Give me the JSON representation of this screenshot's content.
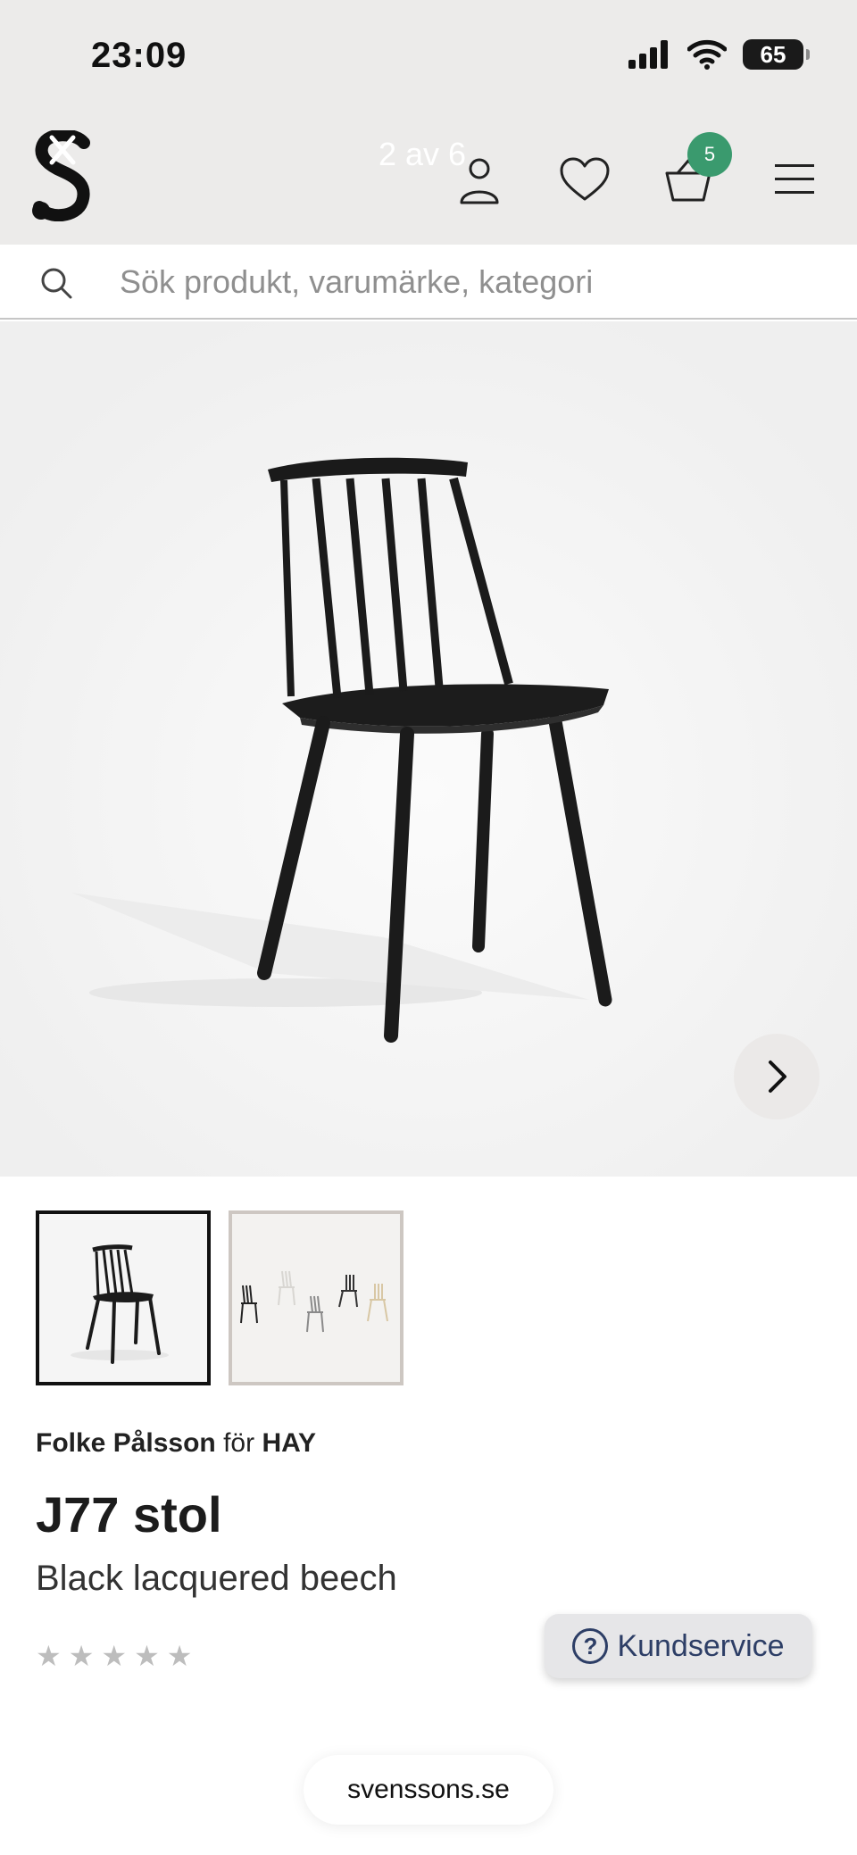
{
  "status_bar": {
    "time": "23:09",
    "battery": "65"
  },
  "header": {
    "gallery_counter": "2 av 6",
    "cart_count": "5",
    "icons": [
      "account-icon",
      "heart-icon",
      "cart-icon",
      "menu-icon"
    ]
  },
  "search": {
    "placeholder": "Sök produkt, varumärke, kategori"
  },
  "product": {
    "designer": "Folke Pålsson",
    "designer_connector": "för",
    "brand": "HAY",
    "title": "J77 stol",
    "variant": "Black lacquered beech",
    "rating_stars": 5,
    "rating_value": 0
  },
  "support": {
    "label": "Kundservice"
  },
  "browser": {
    "url": "svenssons.se"
  },
  "colors": {
    "header_bg": "#ecebea",
    "cart_badge": "#3a9a6e",
    "support_text": "#2d3e66",
    "star_empty": "#bdbdbd"
  }
}
